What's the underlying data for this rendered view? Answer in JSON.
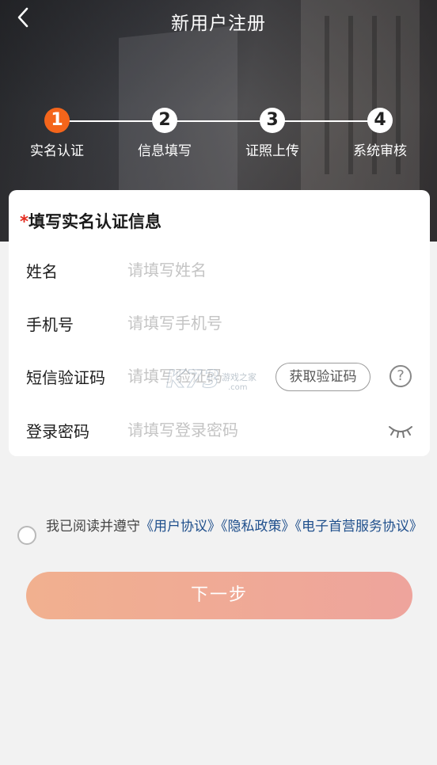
{
  "header": {
    "back_icon": "chevron-left-icon",
    "title": "新用户注册"
  },
  "steps": [
    {
      "number": "1",
      "label": "实名认证",
      "active": true
    },
    {
      "number": "2",
      "label": "信息填写",
      "active": false
    },
    {
      "number": "3",
      "label": "证照上传",
      "active": false
    },
    {
      "number": "4",
      "label": "系统审核",
      "active": false
    }
  ],
  "form": {
    "required_mark": "*",
    "title": "填写实名认证信息",
    "name": {
      "label": "姓名",
      "value": "",
      "placeholder": "请填写姓名"
    },
    "phone": {
      "label": "手机号",
      "value": "",
      "placeholder": "请填写手机号"
    },
    "sms_code": {
      "label": "短信验证码",
      "value": "",
      "placeholder": "请填写验证码",
      "button": "获取验证码",
      "help_icon": "question-circle-icon"
    },
    "password": {
      "label": "登录密码",
      "value": "",
      "placeholder": "请填写登录密码",
      "toggle_icon": "eye-closed-icon"
    }
  },
  "watermark": {
    "main": "K73",
    "sub1": "游戏之家",
    "sub2": ".com"
  },
  "agreement": {
    "checked": false,
    "prefix": "我已阅读并遵守",
    "links": [
      "《用户协议》",
      "《隐私政策》",
      "《电子首营服务协议》"
    ]
  },
  "next_button": "下一步",
  "colors": {
    "accent": "#f4651b",
    "link": "#1f4f8c",
    "required": "#e42a1e",
    "button_gradient_start": "#f1b08f",
    "button_gradient_end": "#eea49c"
  }
}
